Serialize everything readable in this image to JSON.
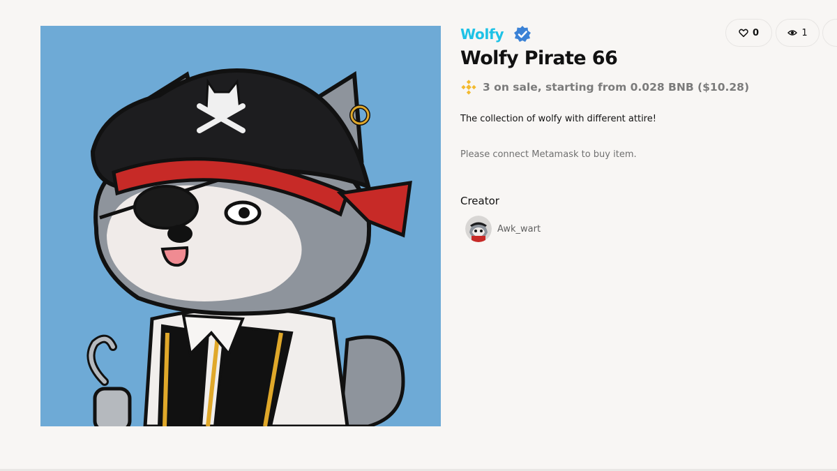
{
  "collection": {
    "name": "Wolfy",
    "verified_icon": "verified-badge-icon",
    "accent_color": "#1ec2e6"
  },
  "item": {
    "title": "Wolfy Pirate 66",
    "sale_text": "3 on sale, starting from 0.028 BNB ($10.28)",
    "currency_icon": "bnb-icon",
    "description": "The collection of wolfy with different attire!",
    "connect_note": "Please connect Metamask to buy item."
  },
  "creator": {
    "heading": "Creator",
    "name": "Awk_wart"
  },
  "stats": {
    "likes": "0",
    "views": "1"
  },
  "colors": {
    "background": "#f8f6f4",
    "artwork_background": "#6eaad6",
    "verified_blue": "#3b82d6",
    "bnb_gold": "#f3ba2f"
  }
}
